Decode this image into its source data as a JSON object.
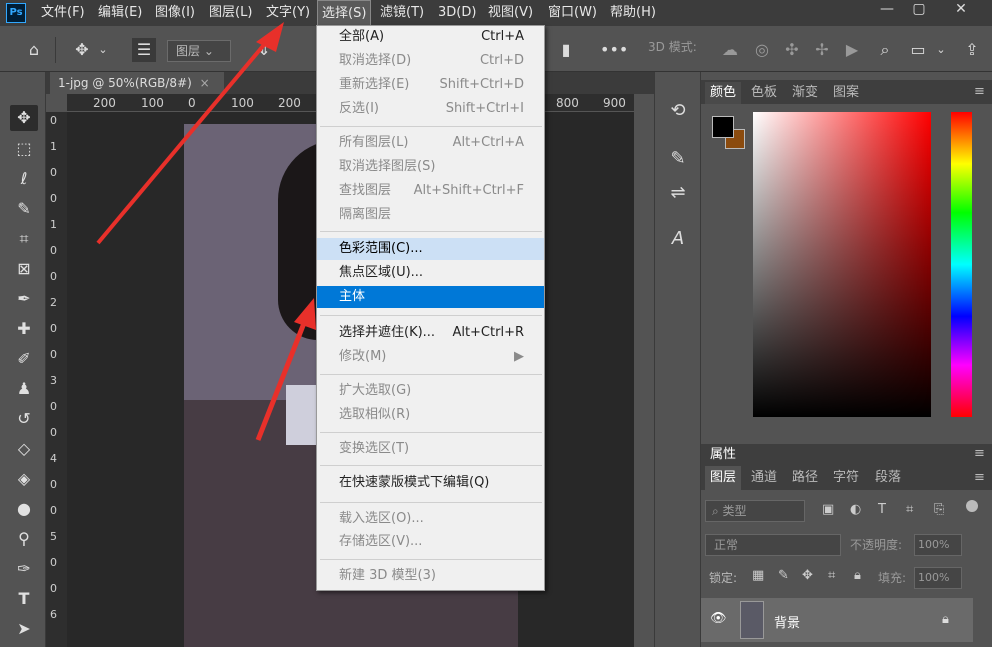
{
  "menubar": {
    "items": [
      "文件(F)",
      "编辑(E)",
      "图像(I)",
      "图层(L)",
      "文字(Y)",
      "选择(S)",
      "滤镜(T)",
      "3D(D)",
      "视图(V)",
      "窗口(W)",
      "帮助(H)"
    ],
    "logo": "Ps",
    "min": "—",
    "max": "▢",
    "close": "✕"
  },
  "options": {
    "layer_dropdown": "图层",
    "mode3d": "3D 模式:"
  },
  "document": {
    "tab": "1-jpg @ 50%(RGB/8#)",
    "close": "×"
  },
  "ruler": {
    "top": [
      "200",
      "100",
      "0",
      "100",
      "200",
      "800",
      "900"
    ],
    "left": [
      "0",
      "1",
      "0",
      "0",
      "1",
      "0",
      "0",
      "2",
      "0",
      "0",
      "3",
      "0",
      "0",
      "4",
      "0",
      "0",
      "5",
      "0",
      "0",
      "6"
    ]
  },
  "menu": {
    "items": [
      {
        "label": "全部(A)",
        "shortcut": "Ctrl+A",
        "state": "normal"
      },
      {
        "label": "取消选择(D)",
        "shortcut": "Ctrl+D",
        "state": "disabled"
      },
      {
        "label": "重新选择(E)",
        "shortcut": "Shift+Ctrl+D",
        "state": "disabled"
      },
      {
        "label": "反选(I)",
        "shortcut": "Shift+Ctrl+I",
        "state": "disabled"
      },
      {
        "label": "所有图层(L)",
        "shortcut": "Alt+Ctrl+A",
        "state": "disabled"
      },
      {
        "label": "取消选择图层(S)",
        "shortcut": "",
        "state": "disabled"
      },
      {
        "label": "查找图层",
        "shortcut": "Alt+Shift+Ctrl+F",
        "state": "disabled"
      },
      {
        "label": "隔离图层",
        "shortcut": "",
        "state": "disabled"
      },
      {
        "label": "色彩范围(C)...",
        "shortcut": "",
        "state": "hover"
      },
      {
        "label": "焦点区域(U)...",
        "shortcut": "",
        "state": "normal"
      },
      {
        "label": "主体",
        "shortcut": "",
        "state": "highlight"
      },
      {
        "label": "选择并遮住(K)...",
        "shortcut": "Alt+Ctrl+R",
        "state": "normal"
      },
      {
        "label": "修改(M)",
        "shortcut": "▶",
        "state": "disabled"
      },
      {
        "label": "扩大选取(G)",
        "shortcut": "",
        "state": "disabled"
      },
      {
        "label": "选取相似(R)",
        "shortcut": "",
        "state": "disabled"
      },
      {
        "label": "变换选区(T)",
        "shortcut": "",
        "state": "disabled"
      },
      {
        "label": "在快速蒙版模式下编辑(Q)",
        "shortcut": "",
        "state": "normal"
      },
      {
        "label": "载入选区(O)...",
        "shortcut": "",
        "state": "disabled"
      },
      {
        "label": "存储选区(V)...",
        "shortcut": "",
        "state": "disabled"
      },
      {
        "label": "新建 3D 模型(3)",
        "shortcut": "",
        "state": "disabled"
      }
    ]
  },
  "color_panel": {
    "tabs": [
      "颜色",
      "色板",
      "渐变",
      "图案"
    ]
  },
  "properties": {
    "title": "属性"
  },
  "layers": {
    "tabs": [
      "图层",
      "通道",
      "路径",
      "字符",
      "段落"
    ],
    "filter": "类型",
    "blend": "正常",
    "opacity_label": "不透明度:",
    "opacity": "100%",
    "lock_label": "锁定:",
    "fill_label": "填充:",
    "fill": "100%",
    "layer_name": "背景"
  },
  "colors": {
    "accent": "#0078d7",
    "fg": "#000000",
    "bg": "#8b4b0e",
    "arrow": "#e8302a"
  }
}
